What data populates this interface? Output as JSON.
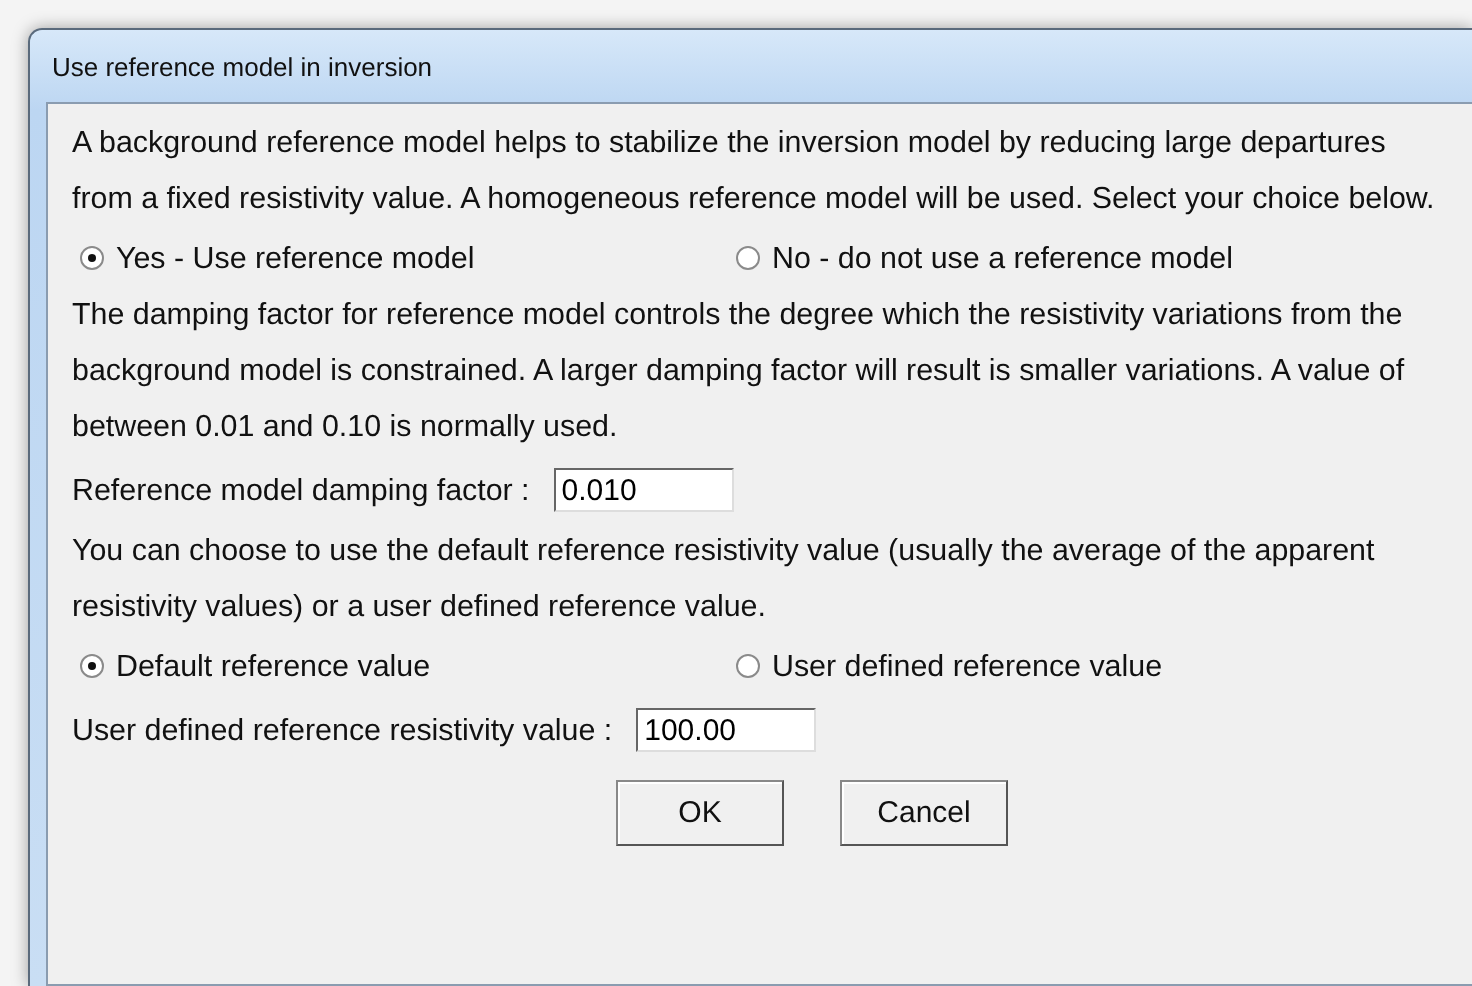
{
  "window": {
    "title": "Use reference model in inversion"
  },
  "sections": [
    {
      "text": "A background reference model helps to stabilize the inversion model by reducing large departures from a fixed resistivity value. A homogeneous reference model will be used. Select your choice below.",
      "options": [
        {
          "label": "Yes - Use reference model",
          "selected": true
        },
        {
          "label": "No - do not use a reference model",
          "selected": false
        }
      ]
    },
    {
      "text": "The damping factor for reference model controls the degree which the resistivity variations from the background model is constrained. A larger damping factor will result is smaller variations. A value of between 0.01 and 0.10 is normally used.",
      "field": {
        "label": "Reference model damping factor :",
        "value": "0.010"
      }
    },
    {
      "text": "You can choose to use the default reference resistivity value (usually the average of the apparent resistivity values) or a user defined reference value.",
      "options": [
        {
          "label": "Default reference value",
          "selected": true
        },
        {
          "label": "User defined reference value",
          "selected": false
        }
      ],
      "field": {
        "label": "User defined reference resistivity value :",
        "value": "100.00"
      }
    }
  ],
  "buttons": [
    "OK",
    "Cancel"
  ]
}
